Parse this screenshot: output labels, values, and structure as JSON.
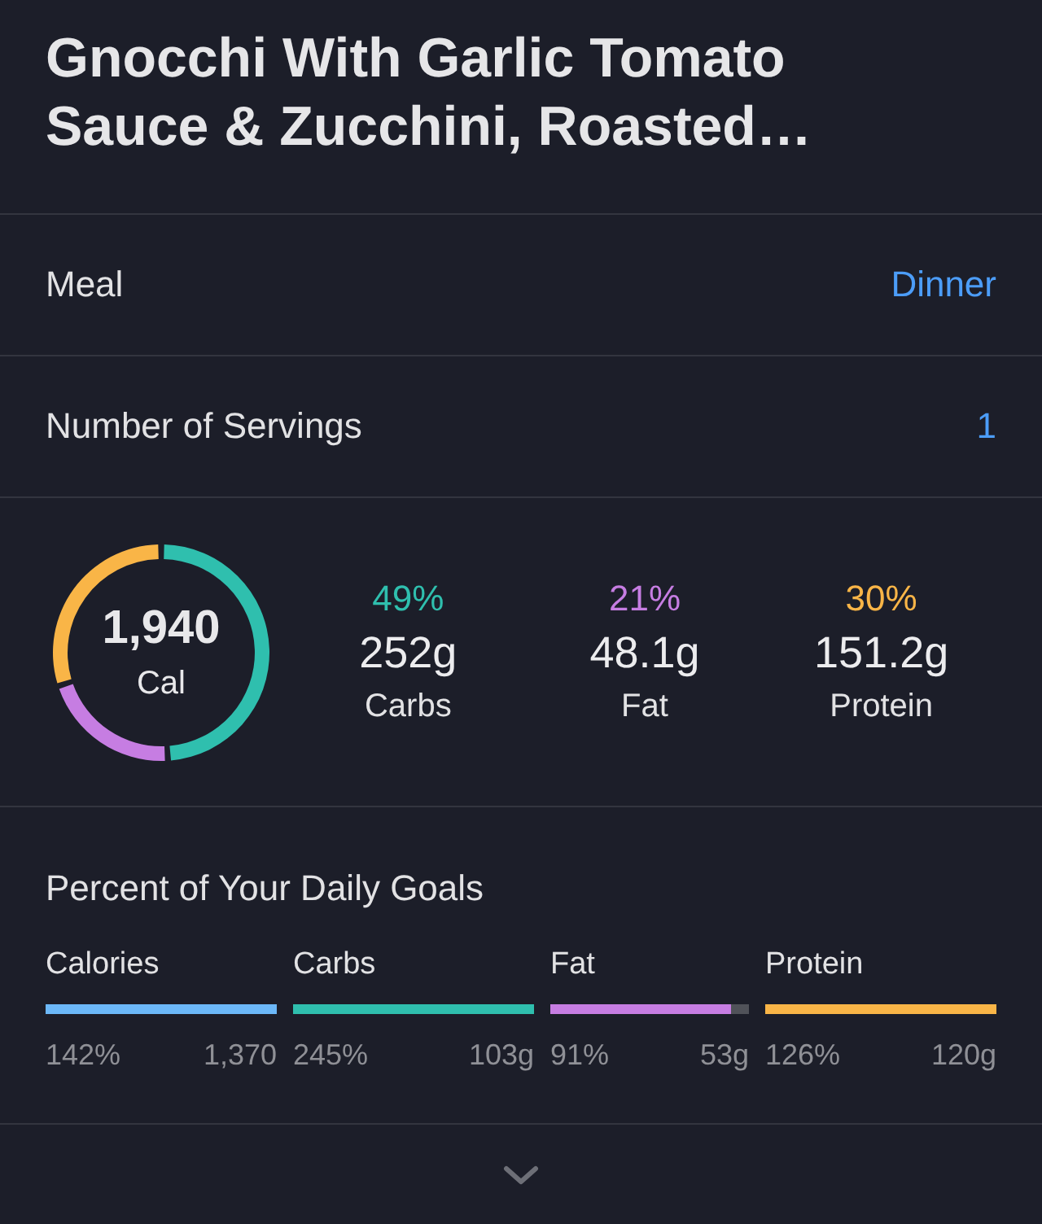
{
  "title": "Gnocchi With Garlic Tomato Sauce & Zucchini, Roasted…",
  "settings": [
    {
      "label": "Meal",
      "value": "Dinner"
    },
    {
      "label": "Number of Servings",
      "value": "1"
    }
  ],
  "summary": {
    "calories": "1,940",
    "unit": "Cal",
    "chart_data": {
      "type": "donut",
      "categories": [
        "Carbs",
        "Fat",
        "Protein"
      ],
      "values": [
        49,
        21,
        30
      ]
    }
  },
  "macros": [
    {
      "percent": "49%",
      "amount": "252g",
      "color": "#2fbfae"
    },
    {
      "percent": "21%",
      "amount": "48.1g",
      "color": "#c67de2"
    },
    {
      "percent": "30%",
      "amount": "151.2g",
      "color": "#f9b547"
    }
  ],
  "daily_goals": {
    "heading": "Percent of Your Daily Goals",
    "items": [
      {
        "label": "Calories",
        "level": 1,
        "percent": "142%",
        "goal": "1,370",
        "color": "#6cb8f8"
      },
      {
        "label": "Carbs",
        "level": 1,
        "percent": "245%",
        "goal": "103g",
        "color": "#2fbfae"
      },
      {
        "label": "Fat",
        "level": 0.91,
        "percent": "91%",
        "goal": "53g",
        "color": "#c67de2"
      },
      {
        "label": "Protein",
        "level": 1,
        "percent": "126%",
        "goal": "120g",
        "color": "#f9b547"
      }
    ]
  }
}
